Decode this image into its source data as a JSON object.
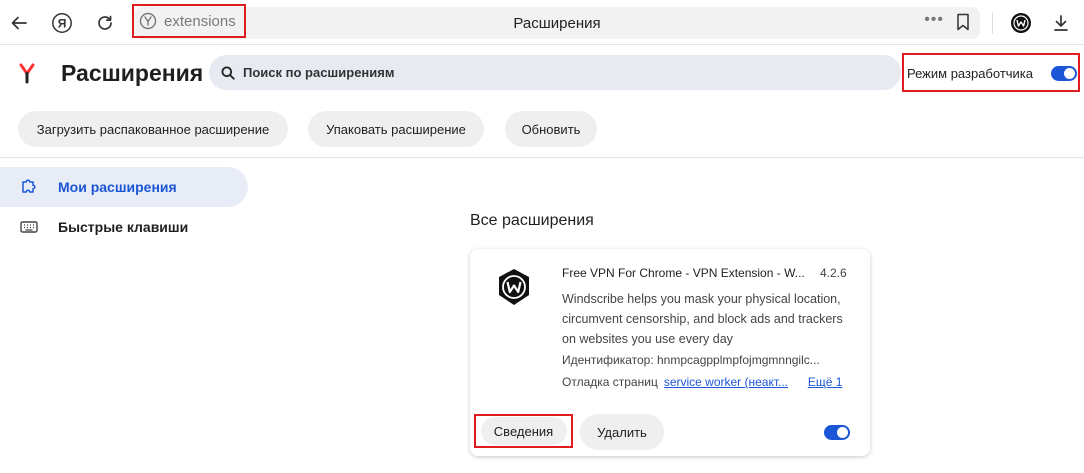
{
  "toolbar": {
    "address_fragment": "extensions",
    "page_title": "Расширения"
  },
  "header": {
    "title": "Расширения",
    "search_placeholder": "Поиск по расширениям",
    "dev_mode_label": "Режим разработчика",
    "dev_mode_on": true
  },
  "actions": {
    "load_unpacked": "Загрузить распакованное расширение",
    "pack": "Упаковать расширение",
    "update": "Обновить"
  },
  "sidebar": {
    "items": [
      {
        "label": "Мои расширения",
        "icon": "puzzle-icon",
        "active": true
      },
      {
        "label": "Быстрые клавиши",
        "icon": "keyboard-icon",
        "active": false
      }
    ]
  },
  "main": {
    "section_title": "Все расширения",
    "extension": {
      "name": "Free VPN For Chrome - VPN Extension - W...",
      "version": "4.2.6",
      "description": "Windscribe helps you mask your physical location, circumvent censorship, and block ads and trackers on websites you use every day",
      "id_label": "Идентификатор: hnmpcagpplmpfojmgmnngilc...",
      "debug_label": "Отладка страниц",
      "debug_link": "service worker (неакт...",
      "debug_more": "Ещё 1",
      "details_button": "Сведения",
      "remove_button": "Удалить",
      "enabled": true,
      "icon": "windscribe-icon"
    }
  },
  "colors": {
    "accent": "#1a56d6",
    "highlight_frame": "#e21b23"
  }
}
